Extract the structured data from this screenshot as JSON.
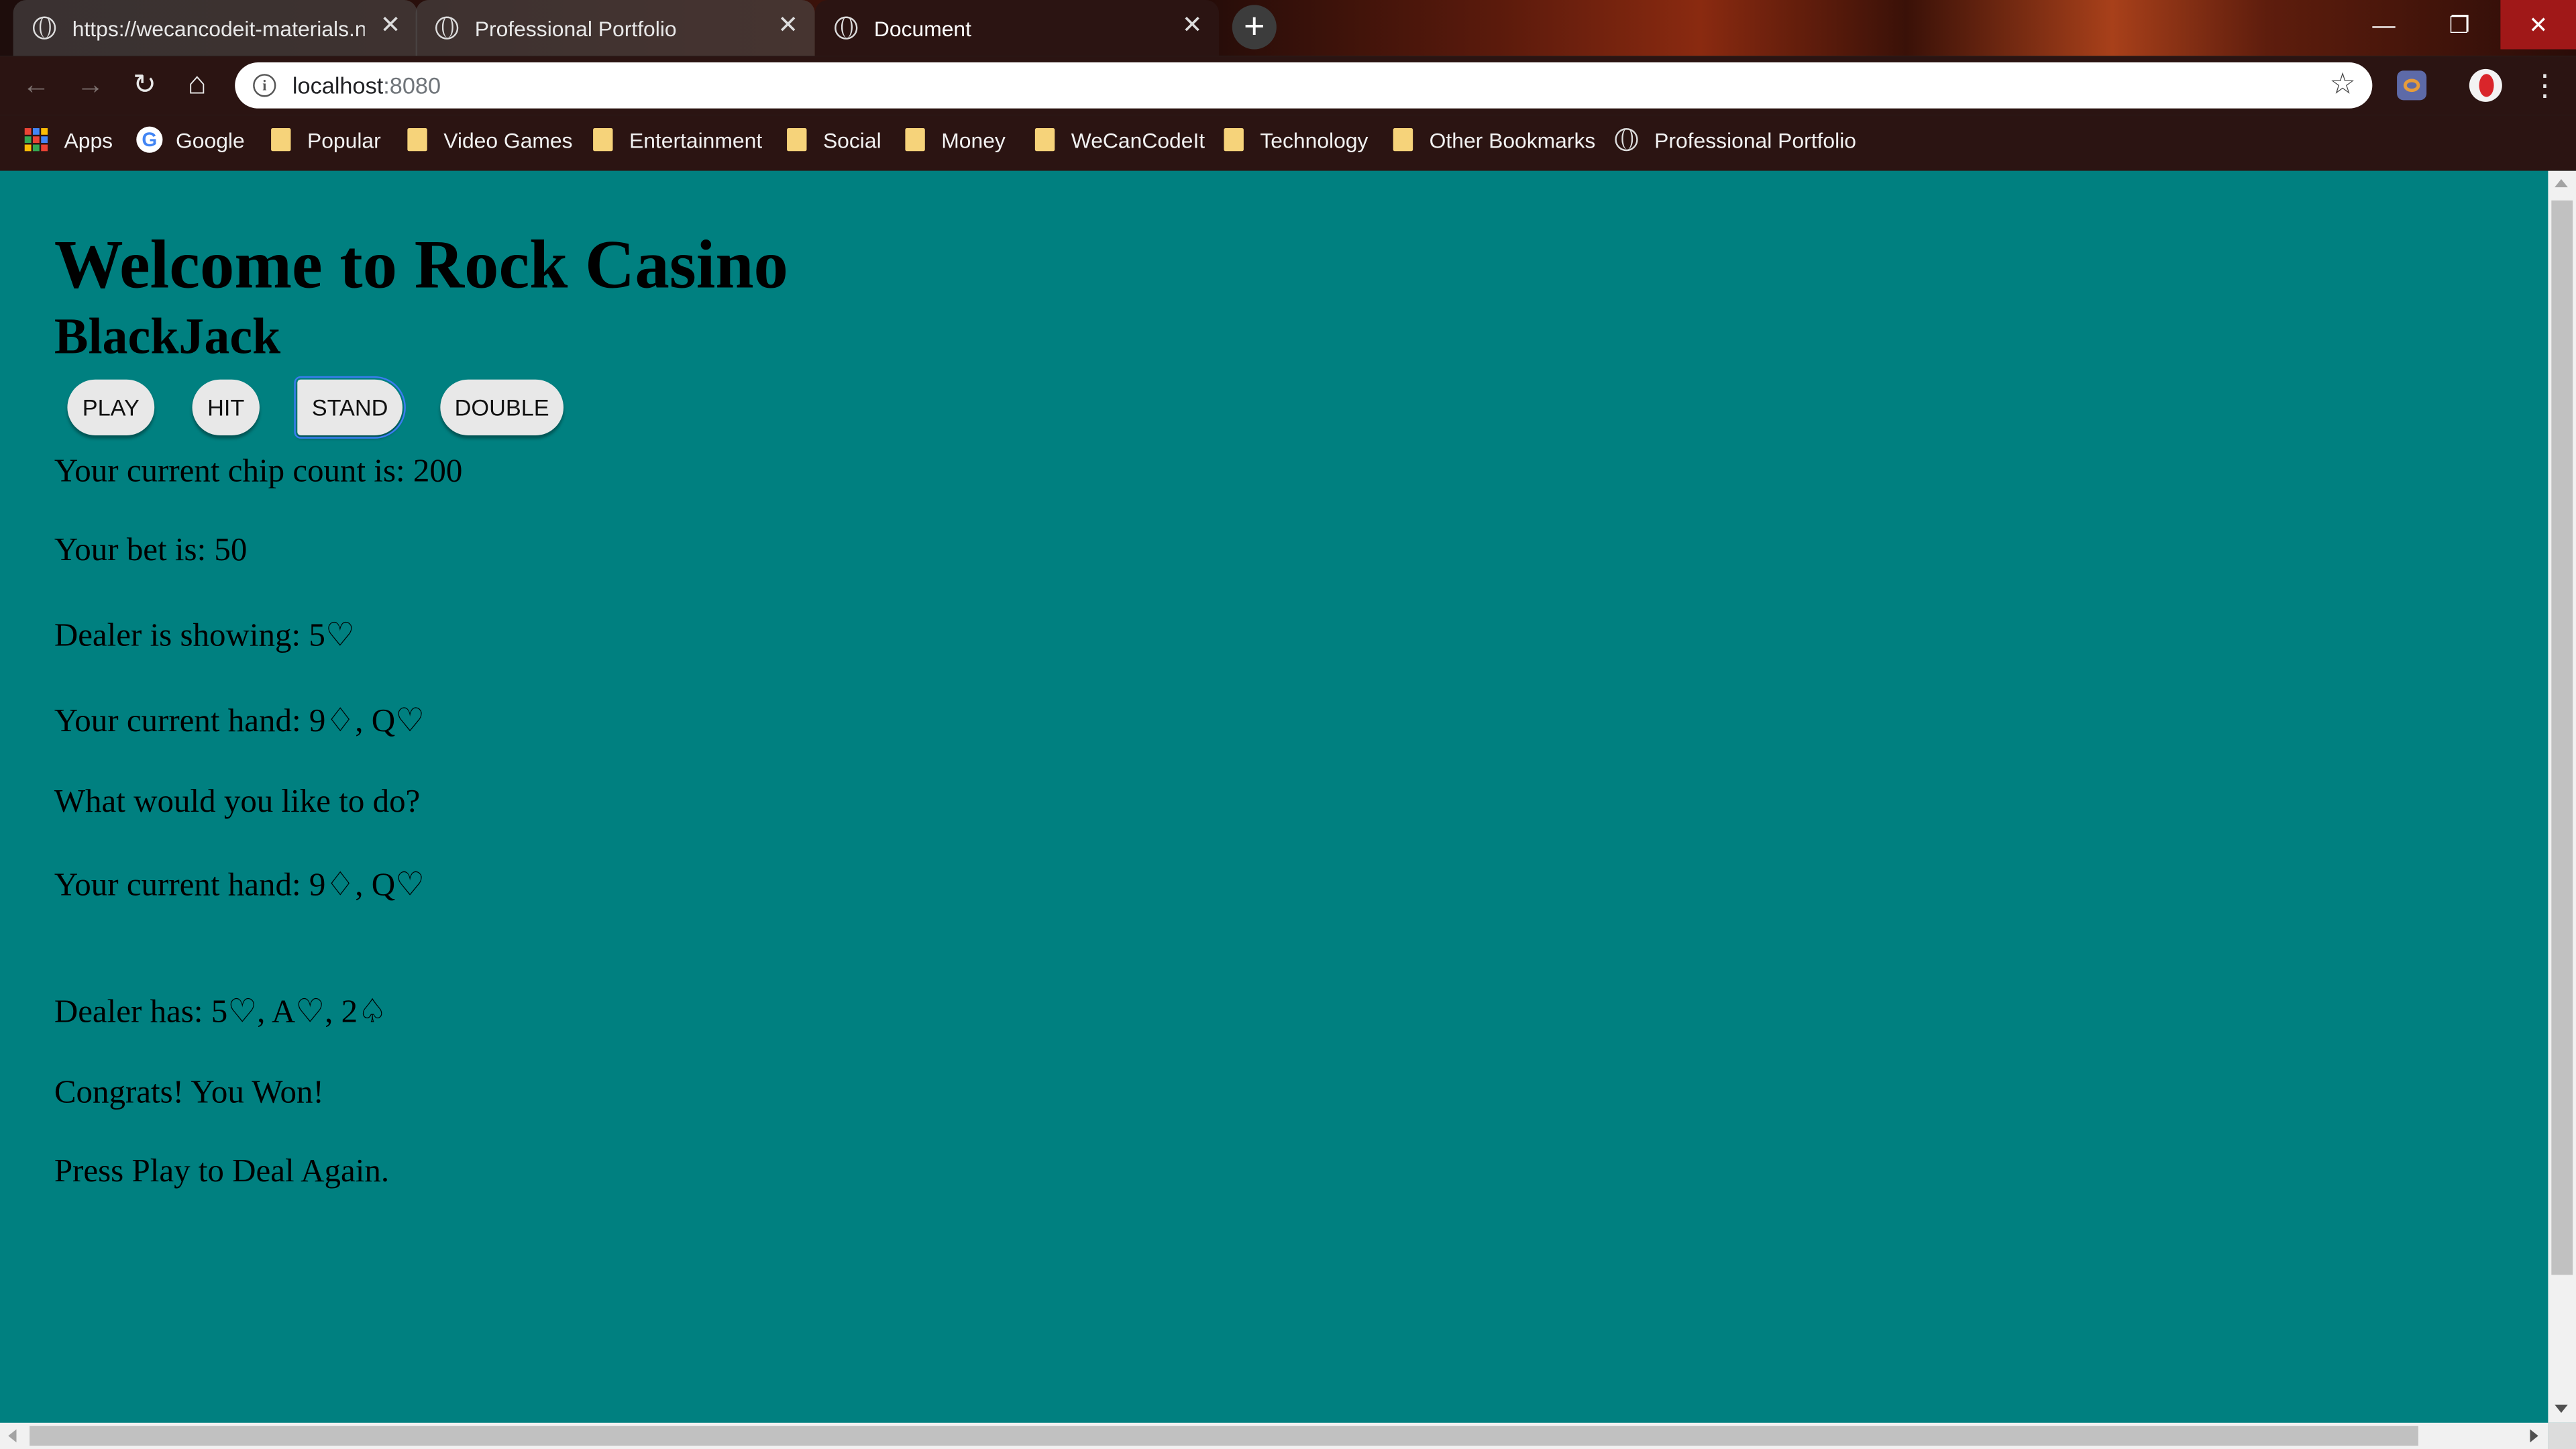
{
  "browser": {
    "tabs": [
      {
        "title": "https://wecancodeit-materials.ne",
        "close": "✕"
      },
      {
        "title": "Professional Portfolio",
        "close": "✕"
      },
      {
        "title": "Document",
        "close": "✕"
      }
    ],
    "new_tab": "+",
    "window_controls": {
      "minimize": "—",
      "restore": "❐",
      "close": "✕"
    },
    "address": {
      "host": "localhost",
      "port": ":8080"
    },
    "nav": {
      "back": "←",
      "forward": "→",
      "reload": "↻",
      "home": "⌂"
    },
    "bookmark_star": "☆",
    "menu": "⋮",
    "bookmarks": [
      {
        "label": "Apps",
        "icon": "apps-grid-icon"
      },
      {
        "label": "Google",
        "icon": "google-icon"
      },
      {
        "label": "Popular",
        "icon": "folder-icon"
      },
      {
        "label": "Video Games",
        "icon": "folder-icon"
      },
      {
        "label": "Entertainment",
        "icon": "folder-icon"
      },
      {
        "label": "Social",
        "icon": "folder-icon"
      },
      {
        "label": "Money",
        "icon": "folder-icon"
      },
      {
        "label": "WeCanCodeIt",
        "icon": "folder-icon"
      },
      {
        "label": "Technology",
        "icon": "folder-icon"
      },
      {
        "label": "Other Bookmarks",
        "icon": "folder-icon"
      },
      {
        "label": "Professional Portfolio",
        "icon": "globe-icon"
      }
    ]
  },
  "page": {
    "title": "Welcome to Rock Casino",
    "subtitle": "BlackJack",
    "buttons": {
      "play": "PLAY",
      "hit": "HIT",
      "stand": "STAND",
      "double": "DOUBLE"
    },
    "lines": [
      "Your current chip count is: 200",
      "Your bet is: 50",
      "Dealer is showing: 5♡",
      "Your current hand: 9♢, Q♡",
      "What would you like to do?",
      "Your current hand: 9♢, Q♡",
      "Dealer has: 5♡, A♡, 2♤",
      "Congrats! You Won!",
      "Press Play to Deal Again."
    ]
  },
  "colors": {
    "page_background": "#008080",
    "chrome": "#2b1412"
  }
}
